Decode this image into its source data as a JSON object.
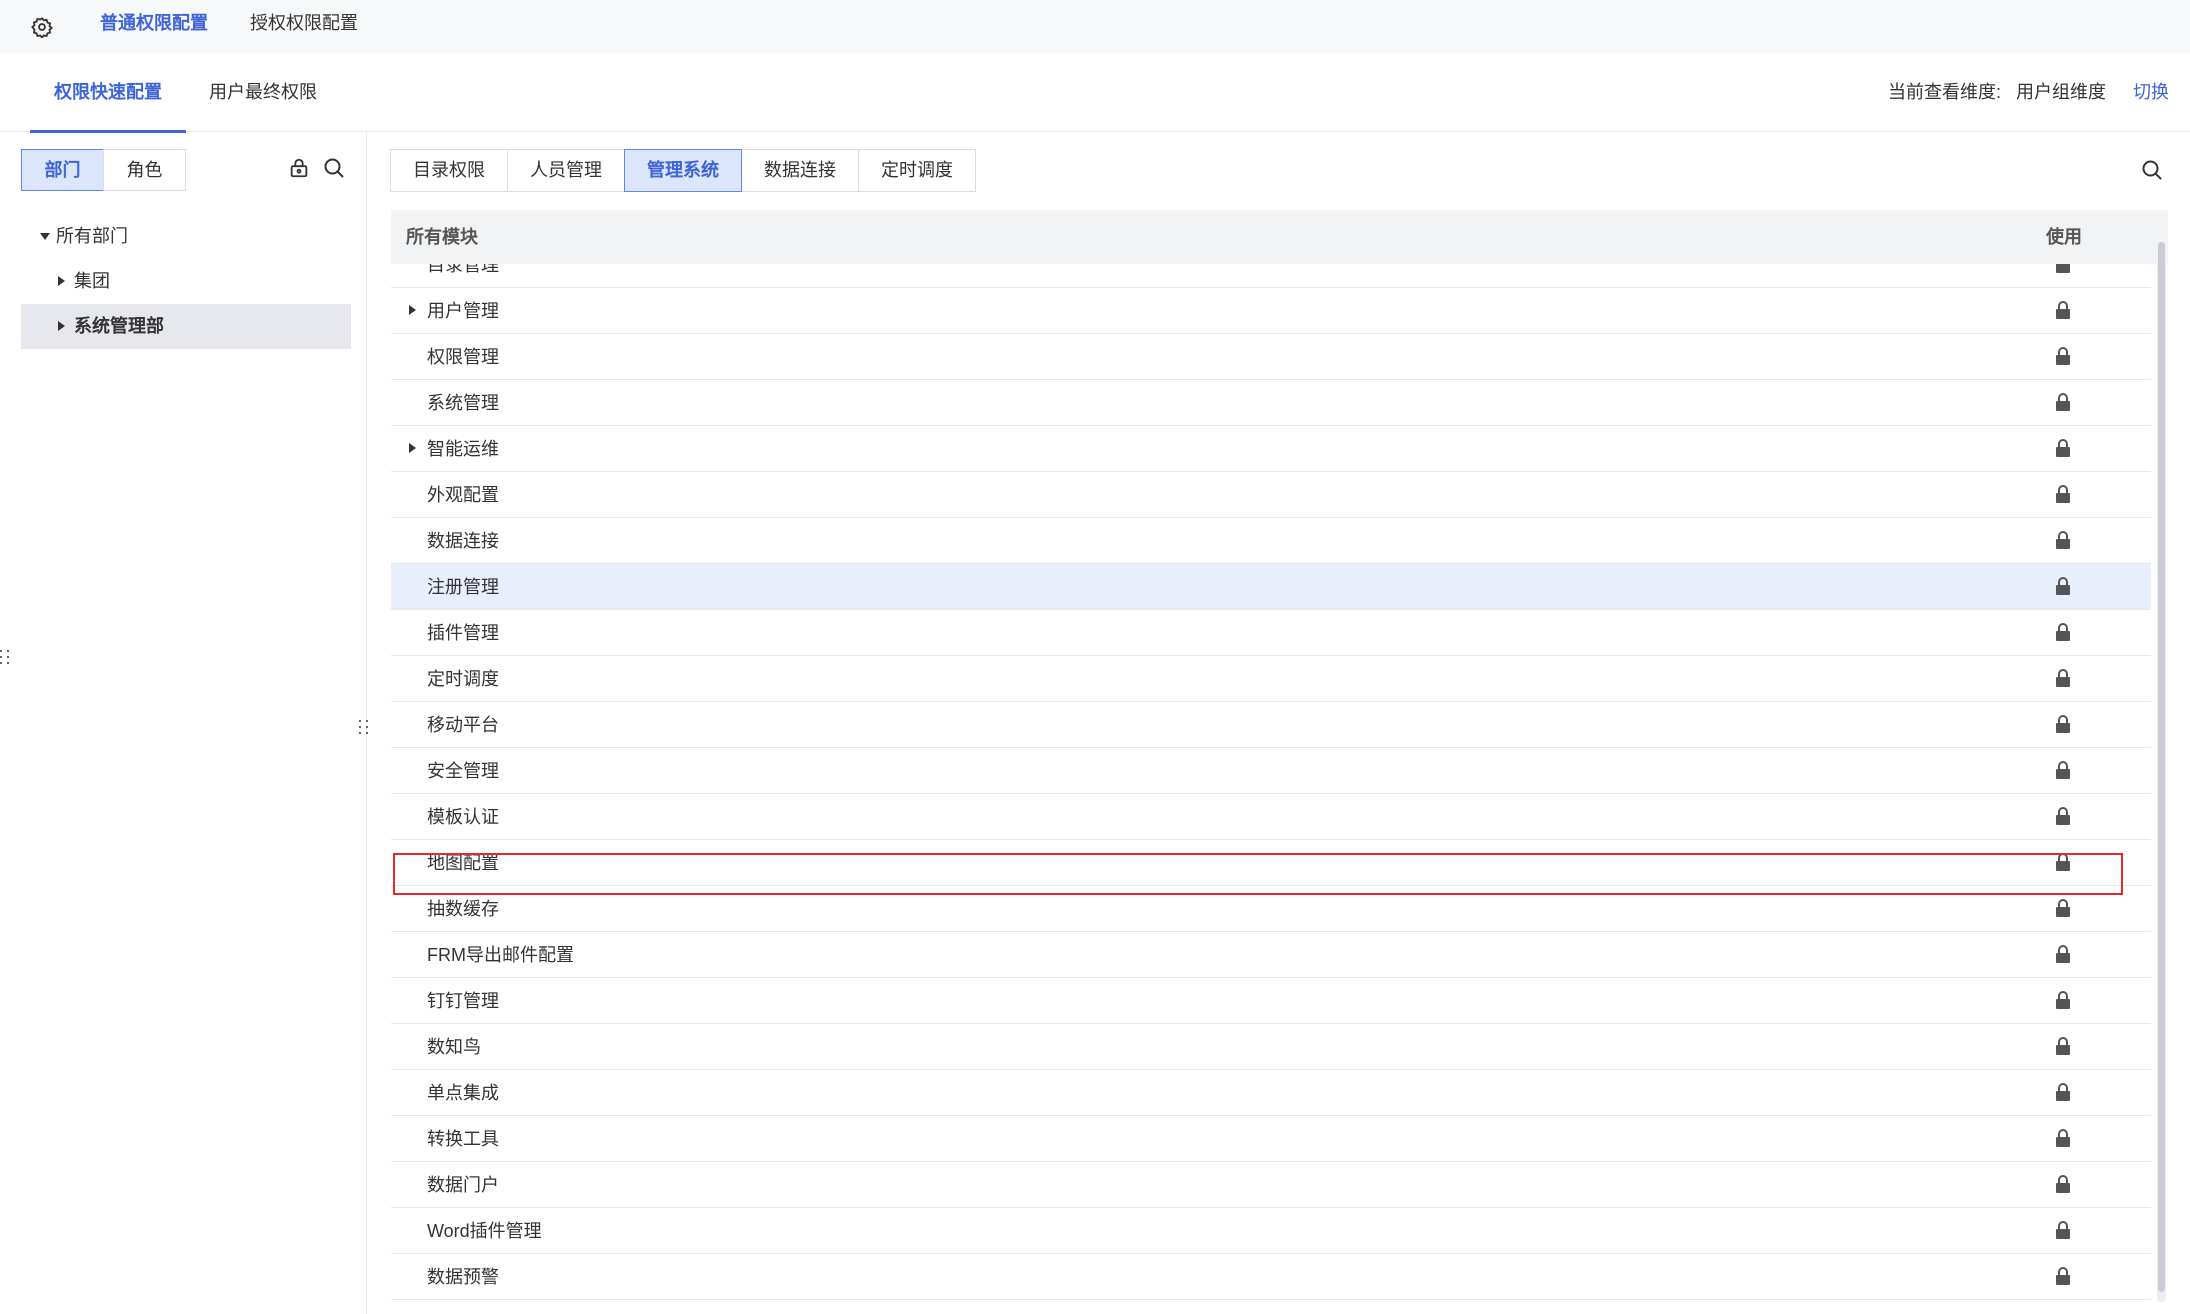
{
  "topbar": {
    "settings_icon": "gear-icon",
    "tabs": [
      {
        "label": "普通权限配置",
        "active": true
      },
      {
        "label": "授权权限配置",
        "active": false
      }
    ]
  },
  "subheader": {
    "tabs": [
      {
        "label": "权限快速配置",
        "active": true
      },
      {
        "label": "用户最终权限",
        "active": false
      }
    ],
    "dimension_label": "当前查看维度:",
    "dimension_value": "用户组维度",
    "switch_label": "切换"
  },
  "left": {
    "segments": [
      {
        "label": "部门",
        "active": true
      },
      {
        "label": "角色",
        "active": false
      }
    ],
    "icons": [
      "lock-settings-icon",
      "search-icon"
    ],
    "tree": [
      {
        "label": "所有部门",
        "expanded": true,
        "level": 0
      },
      {
        "label": "集团",
        "expanded": false,
        "level": 1
      },
      {
        "label": "系统管理部",
        "expanded": false,
        "level": 1,
        "selected": true
      }
    ]
  },
  "main": {
    "tabs": [
      {
        "label": "目录权限",
        "active": false
      },
      {
        "label": "人员管理",
        "active": false
      },
      {
        "label": "管理系统",
        "active": true
      },
      {
        "label": "数据连接",
        "active": false
      },
      {
        "label": "定时调度",
        "active": false
      }
    ],
    "search_icon": "search-icon",
    "table": {
      "header_module": "所有模块",
      "header_use": "使用",
      "rows": [
        {
          "label": "目录管理",
          "expandable": false
        },
        {
          "label": "用户管理",
          "expandable": true
        },
        {
          "label": "权限管理",
          "expandable": false
        },
        {
          "label": "系统管理",
          "expandable": false
        },
        {
          "label": "智能运维",
          "expandable": true
        },
        {
          "label": "外观配置",
          "expandable": false
        },
        {
          "label": "数据连接",
          "expandable": false
        },
        {
          "label": "注册管理",
          "expandable": false,
          "highlight": true
        },
        {
          "label": "插件管理",
          "expandable": false
        },
        {
          "label": "定时调度",
          "expandable": false
        },
        {
          "label": "移动平台",
          "expandable": false
        },
        {
          "label": "安全管理",
          "expandable": false
        },
        {
          "label": "模板认证",
          "expandable": false
        },
        {
          "label": "地图配置",
          "expandable": false,
          "boxed": true
        },
        {
          "label": "抽数缓存",
          "expandable": false
        },
        {
          "label": "FRM导出邮件配置",
          "expandable": false
        },
        {
          "label": "钉钉管理",
          "expandable": false
        },
        {
          "label": "数知鸟",
          "expandable": false
        },
        {
          "label": "单点集成",
          "expandable": false
        },
        {
          "label": "转换工具",
          "expandable": false
        },
        {
          "label": "数据门户",
          "expandable": false
        },
        {
          "label": "Word插件管理",
          "expandable": false
        },
        {
          "label": "数据预警",
          "expandable": false
        }
      ]
    }
  },
  "colors": {
    "accent": "#3d64d8",
    "highlight_row": "#e8eefb",
    "annotation_box": "#e8262b"
  }
}
